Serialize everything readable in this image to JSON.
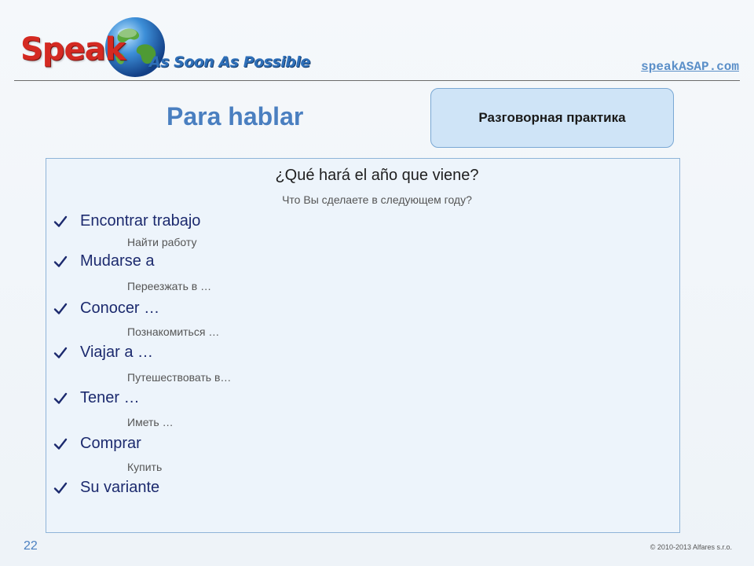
{
  "header": {
    "logo_speak": "Speak",
    "logo_tagline": "As Soon As Possible",
    "site_link": "speakASAP.com"
  },
  "title": "Para hablar",
  "badge": "Разговорная практика",
  "question": {
    "text": "¿Qué hará el año que viene?",
    "translation": "Что Вы сделаете в следующем году?"
  },
  "items": [
    {
      "label": "Encontrar trabajo",
      "translation": "Найти работу"
    },
    {
      "label": "Mudarse a",
      "translation": "Переезжать в …"
    },
    {
      "label": "Conocer …",
      "translation": "Познакомиться …"
    },
    {
      "label": "Viajar a …",
      "translation": "Путешествовать в…"
    },
    {
      "label": "Tener …",
      "translation": "Иметь …"
    },
    {
      "label": "Comprar",
      "translation": "Купить"
    },
    {
      "label": "Su variante",
      "translation": ""
    }
  ],
  "footer": {
    "slide_number": "22",
    "copyright": "© 2010-2013 Alfares s.r.o."
  },
  "icons": {
    "item_marker": "check-icon",
    "logo_image": "globe-icon"
  },
  "colors": {
    "title": "#4a7fc0",
    "logo_red": "#d42a22",
    "logo_blue": "#2e6fb8",
    "item_text": "#1c2a6e",
    "badge_bg": "#cfe4f7"
  }
}
